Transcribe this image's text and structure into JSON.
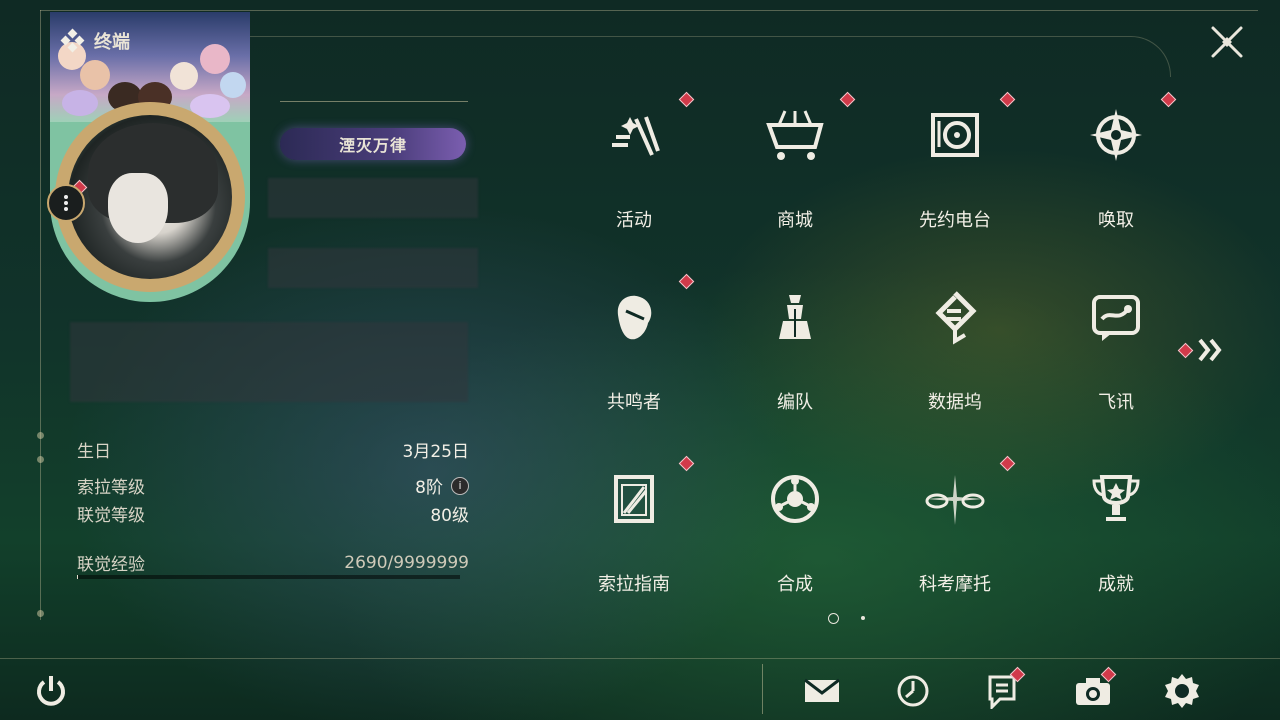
{
  "header": {
    "title": "终端"
  },
  "profile": {
    "title_tag": "湮灭万律",
    "stats": [
      {
        "label": "生日",
        "value": "3月25日"
      },
      {
        "label": "索拉等级",
        "value": "8阶"
      },
      {
        "label": "联觉等级",
        "value": "80级"
      },
      {
        "label": "联觉经验",
        "value": "2690/9999999"
      }
    ],
    "exp_progress": 0.00027
  },
  "grid": {
    "items": [
      {
        "label": "活动",
        "icon": "activity-icon",
        "badge": true
      },
      {
        "label": "商城",
        "icon": "shop-cart-icon",
        "badge": true
      },
      {
        "label": "先约电台",
        "icon": "radio-icon",
        "badge": true
      },
      {
        "label": "唤取",
        "icon": "summon-compass-icon",
        "badge": true
      },
      {
        "label": "共鸣者",
        "icon": "resonator-icon",
        "badge": true
      },
      {
        "label": "编队",
        "icon": "team-chess-icon",
        "badge": false
      },
      {
        "label": "数据坞",
        "icon": "data-dock-icon",
        "badge": false
      },
      {
        "label": "飞讯",
        "icon": "message-icon",
        "badge": false
      },
      {
        "label": "索拉指南",
        "icon": "guide-book-icon",
        "badge": true
      },
      {
        "label": "合成",
        "icon": "synthesis-icon",
        "badge": false
      },
      {
        "label": "科考摩托",
        "icon": "motorbike-icon",
        "badge": true
      },
      {
        "label": "成就",
        "icon": "trophy-icon",
        "badge": false
      }
    ],
    "pages": 2,
    "current_page": 1
  },
  "colors": {
    "badge": "#d13a4a",
    "accent_gold": "#c9a86f",
    "text": "#f2efe6"
  },
  "bottom_bar": [
    "power-icon",
    "mail-icon",
    "clock-icon",
    "notice-icon",
    "camera-icon",
    "settings-gear-icon"
  ]
}
